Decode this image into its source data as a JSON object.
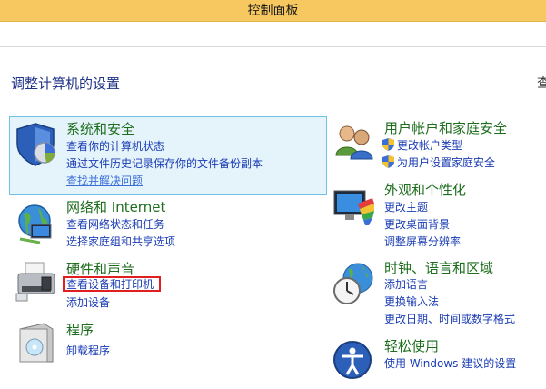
{
  "window": {
    "title": "控制面板"
  },
  "main": {
    "heading": "调整计算机的设置",
    "view_by": "查"
  },
  "categories": {
    "system": {
      "title": "系统和安全",
      "links": [
        "查看你的计算机状态",
        "通过文件历史记录保存你的文件备份副本",
        "查找并解决问题"
      ]
    },
    "network": {
      "title": "网络和 Internet",
      "links": [
        "查看网络状态和任务",
        "选择家庭组和共享选项"
      ]
    },
    "hardware": {
      "title": "硬件和声音",
      "links": [
        "查看设备和打印机",
        "添加设备"
      ]
    },
    "programs": {
      "title": "程序",
      "links": [
        "卸载程序"
      ]
    },
    "users": {
      "title": "用户帐户和家庭安全",
      "links": [
        "更改帐户类型",
        "为用户设置家庭安全"
      ]
    },
    "appearance": {
      "title": "外观和个性化",
      "links": [
        "更改主题",
        "更改桌面背景",
        "调整屏幕分辨率"
      ]
    },
    "clock": {
      "title": "时钟、语言和区域",
      "links": [
        "添加语言",
        "更换输入法",
        "更改日期、时间或数字格式"
      ]
    },
    "ease": {
      "title": "轻松使用",
      "links": [
        "使用 Windows 建议的设置"
      ]
    }
  },
  "colors": {
    "title_bar": "#f6c85f",
    "heading": "#1e3287",
    "category_title": "#1e6e1e",
    "link": "#1a3cb4",
    "highlight": "#e5f3fb",
    "annotation_box": "#e02020"
  },
  "icons": [
    "shield-icon",
    "network-globe-icon",
    "printer-icon",
    "programs-box-icon",
    "users-icon",
    "appearance-icon",
    "clock-globe-icon",
    "ease-of-access-icon",
    "uac-shield-icon"
  ]
}
